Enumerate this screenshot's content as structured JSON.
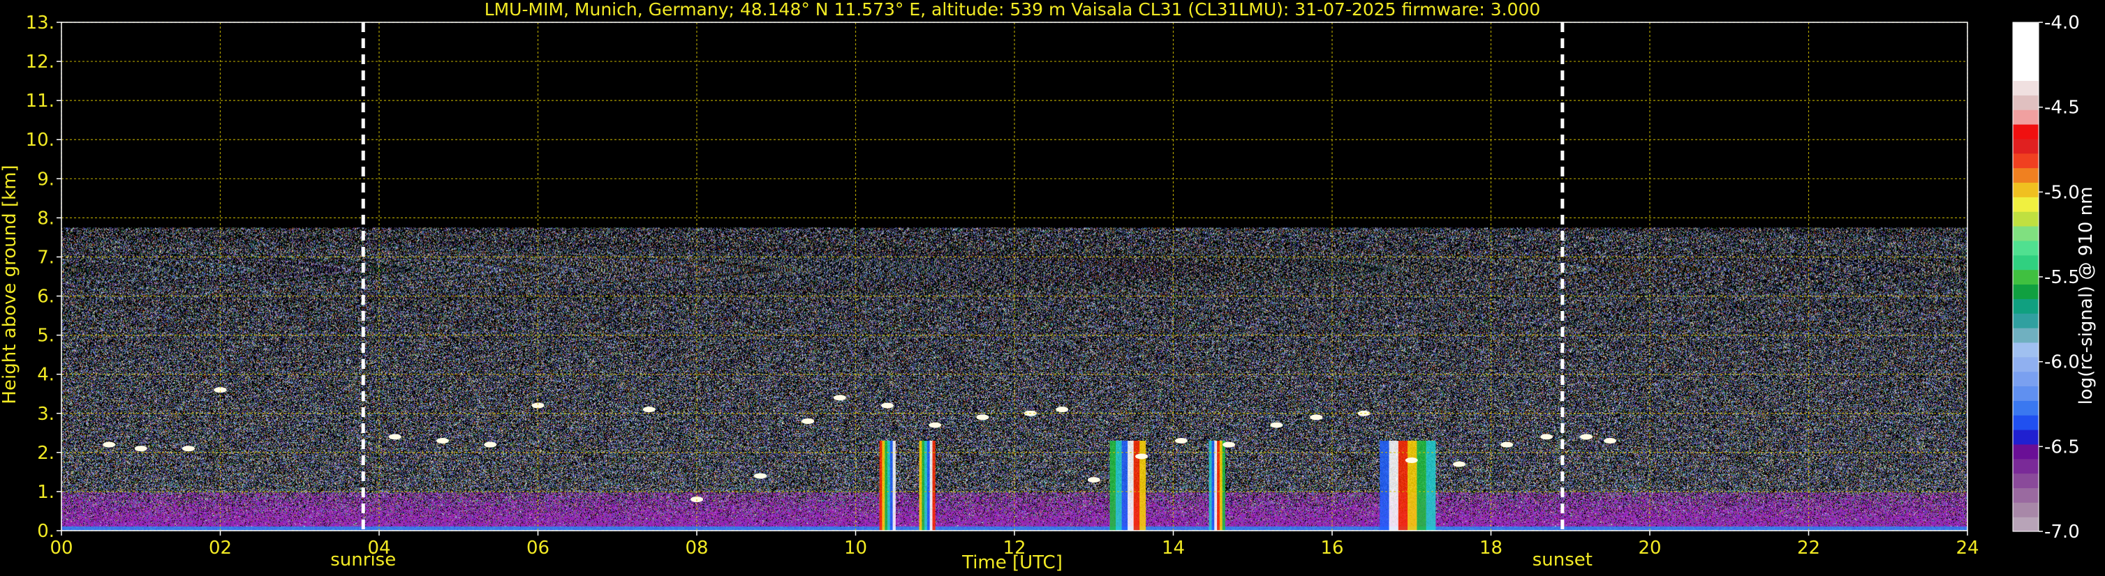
{
  "chart_data": {
    "type": "heatmap",
    "title": "LMU-MIM, Munich, Germany; 48.148° N 11.573° E, altitude: 539 m    Vaisala CL31 (CL31LMU): 31-07-2025    firmware: 3.000",
    "xlabel": "Time [UTC]",
    "ylabel": "Height above ground [km]",
    "xlim": [
      0,
      24
    ],
    "ylim": [
      0,
      13
    ],
    "x_ticks": [
      "00",
      "02",
      "04",
      "06",
      "08",
      "10",
      "12",
      "14",
      "16",
      "18",
      "20",
      "22",
      "24"
    ],
    "y_ticks": [
      "0.",
      "1.",
      "2.",
      "3.",
      "4.",
      "5.",
      "6.",
      "7.",
      "8.",
      "9.",
      "10.",
      "11.",
      "12.",
      "13."
    ],
    "grid": true,
    "markers": [
      {
        "label": "sunrise",
        "time": 3.8
      },
      {
        "label": "sunset",
        "time": 18.9
      }
    ],
    "signal_top_km": 7.75,
    "colorbar": {
      "label": "log(rc-signal) @ 910 nm",
      "range": [
        -7.0,
        -4.0
      ],
      "ticks": [
        "-4.0",
        "-4.5",
        "-5.0",
        "-5.5",
        "-6.0",
        "-6.5",
        "-7.0"
      ]
    },
    "cloud_layer": [
      {
        "t": 0.6,
        "h": 2.2
      },
      {
        "t": 1.0,
        "h": 2.1
      },
      {
        "t": 1.6,
        "h": 2.1
      },
      {
        "t": 2.0,
        "h": 3.6
      },
      {
        "t": 4.2,
        "h": 2.4
      },
      {
        "t": 4.8,
        "h": 2.3
      },
      {
        "t": 5.4,
        "h": 2.2
      },
      {
        "t": 6.0,
        "h": 3.2
      },
      {
        "t": 7.4,
        "h": 3.1
      },
      {
        "t": 8.0,
        "h": 0.8
      },
      {
        "t": 8.8,
        "h": 1.4
      },
      {
        "t": 9.4,
        "h": 2.8
      },
      {
        "t": 9.8,
        "h": 3.4
      },
      {
        "t": 10.4,
        "h": 3.2
      },
      {
        "t": 11.0,
        "h": 2.7
      },
      {
        "t": 11.6,
        "h": 2.9
      },
      {
        "t": 12.2,
        "h": 3.0
      },
      {
        "t": 12.6,
        "h": 3.1
      },
      {
        "t": 13.0,
        "h": 1.3
      },
      {
        "t": 13.6,
        "h": 1.9
      },
      {
        "t": 14.1,
        "h": 2.3
      },
      {
        "t": 14.7,
        "h": 2.2
      },
      {
        "t": 15.3,
        "h": 2.7
      },
      {
        "t": 15.8,
        "h": 2.9
      },
      {
        "t": 16.4,
        "h": 3.0
      },
      {
        "t": 17.0,
        "h": 1.8
      },
      {
        "t": 17.6,
        "h": 1.7
      },
      {
        "t": 18.2,
        "h": 2.2
      },
      {
        "t": 18.7,
        "h": 2.4
      },
      {
        "t": 19.2,
        "h": 2.4
      },
      {
        "t": 19.5,
        "h": 2.3
      }
    ],
    "precip_columns": [
      {
        "t0": 10.3,
        "t1": 10.5
      },
      {
        "t0": 10.8,
        "t1": 11.0
      },
      {
        "t0": 13.2,
        "t1": 13.65
      },
      {
        "t0": 14.45,
        "t1": 14.65
      },
      {
        "t0": 16.6,
        "t1": 17.3
      }
    ]
  }
}
